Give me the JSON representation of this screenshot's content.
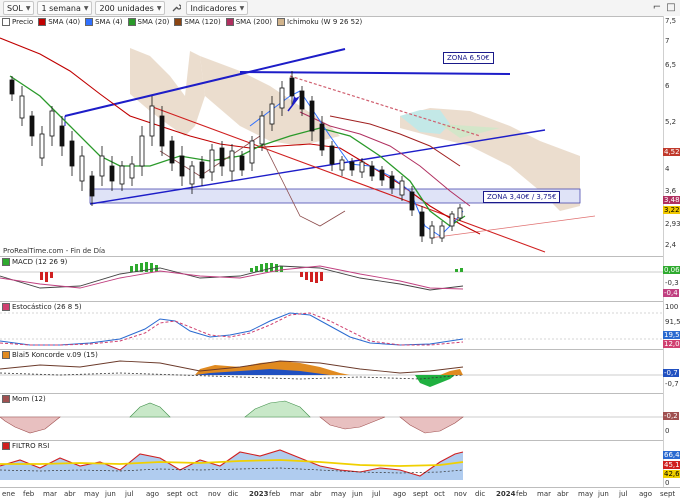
{
  "toolbar": {
    "symbol": "SOL",
    "interval": "1 semana",
    "units": "200 unidades",
    "indicators": "Indicadores"
  },
  "main": {
    "legend": [
      {
        "label": "Precio",
        "color": "#ffffff"
      },
      {
        "label": "SMA (40)",
        "color": "#c00000"
      },
      {
        "label": "SMA (4)",
        "color": "#3070ff"
      },
      {
        "label": "SMA (20)",
        "color": "#2a9a2a"
      },
      {
        "label": "SMA (120)",
        "color": "#8b4513"
      },
      {
        "label": "SMA (200)",
        "color": "#b03060"
      },
      {
        "label": "Ichimoku (W 9 26 52)",
        "color": "#d2b48c"
      }
    ],
    "zone_top": "ZONA 6,50€",
    "zone_mid": "ZONA 3,40€ / 3,75€",
    "footer": "ProRealTime.com - Fin de Día",
    "yticks": [
      "7,5",
      "7",
      "6,5",
      "6",
      "5,2",
      "4,52",
      "4",
      "3,6",
      "3,48",
      "3,22",
      "2,93",
      "2,4"
    ],
    "price_highlight": "3,22"
  },
  "macd": {
    "label": "MACD (12 26 9)",
    "yticks": [
      "0,06",
      "-0,3",
      "-0,4"
    ]
  },
  "stoch": {
    "label": "Estocástico (26 8 5)",
    "yticks": [
      "100",
      "91,5",
      "19,5",
      "12,0"
    ]
  },
  "blai": {
    "label": "Blai5 Koncorde v.09 (15)",
    "yticks": [
      "-0,7",
      "-0,7"
    ]
  },
  "mom": {
    "label": "Mom (12)",
    "yticks": [
      "-0,2",
      "0"
    ]
  },
  "rsi": {
    "label": "FILTRO RSI",
    "yticks": [
      "66,4",
      "45,1",
      "42,6",
      "0"
    ]
  },
  "xaxis": {
    "labels": [
      {
        "t": "ene",
        "bold": false
      },
      {
        "t": "feb",
        "bold": false
      },
      {
        "t": "mar",
        "bold": false
      },
      {
        "t": "abr",
        "bold": false
      },
      {
        "t": "may",
        "bold": false
      },
      {
        "t": "jun",
        "bold": false
      },
      {
        "t": "jul",
        "bold": false
      },
      {
        "t": "ago",
        "bold": false
      },
      {
        "t": "sept",
        "bold": false
      },
      {
        "t": "oct",
        "bold": false
      },
      {
        "t": "nov",
        "bold": false
      },
      {
        "t": "dic",
        "bold": false
      },
      {
        "t": "2023",
        "bold": true
      },
      {
        "t": "feb",
        "bold": false
      },
      {
        "t": "mar",
        "bold": false
      },
      {
        "t": "abr",
        "bold": false
      },
      {
        "t": "may",
        "bold": false
      },
      {
        "t": "jun",
        "bold": false
      },
      {
        "t": "jul",
        "bold": false
      },
      {
        "t": "ago",
        "bold": false
      },
      {
        "t": "sept",
        "bold": false
      },
      {
        "t": "oct",
        "bold": false
      },
      {
        "t": "nov",
        "bold": false
      },
      {
        "t": "dic",
        "bold": false
      },
      {
        "t": "2024",
        "bold": true
      },
      {
        "t": "feb",
        "bold": false
      },
      {
        "t": "mar",
        "bold": false
      },
      {
        "t": "abr",
        "bold": false
      },
      {
        "t": "may",
        "bold": false
      },
      {
        "t": "jun",
        "bold": false
      },
      {
        "t": "jul",
        "bold": false
      },
      {
        "t": "ago",
        "bold": false
      },
      {
        "t": "sept",
        "bold": false
      }
    ]
  }
}
